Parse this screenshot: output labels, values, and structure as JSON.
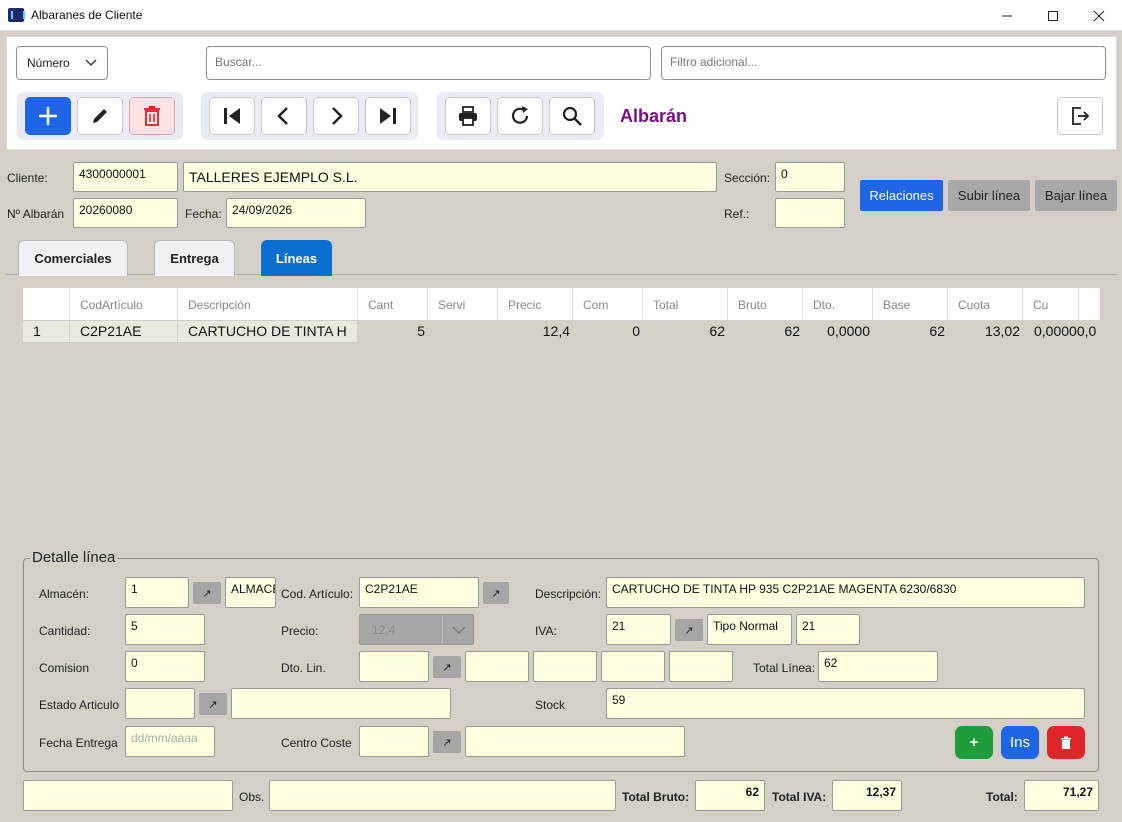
{
  "window": {
    "title": "Albaranes de Cliente"
  },
  "toolbar": {
    "search_mode": "Número",
    "search_placeholder": "Buscar...",
    "filter_placeholder": "Filtro adicional...",
    "doc_title": "Albarán"
  },
  "header": {
    "cliente_label": "Cliente:",
    "cliente_code": "4300000001",
    "cliente_name": "TALLERES EJEMPLO S.L.",
    "seccion_label": "Sección:",
    "seccion_value": "0",
    "albaran_label": "Nº Albarán",
    "albaran_value": "20260080",
    "fecha_label": "Fecha:",
    "fecha_value": "24/09/2026",
    "ref_label": "Ref.:",
    "ref_value": "",
    "relaciones_label": "Relaciones",
    "subir_label": "Subir línea",
    "bajar_label": "Bajar línea"
  },
  "tabs": [
    {
      "label": "Comerciales"
    },
    {
      "label": "Entrega"
    },
    {
      "label": "Líneas"
    }
  ],
  "grid": {
    "columns": [
      "",
      "CodArtículo",
      "Descripción",
      "Cant",
      "Servi",
      "Precic",
      "Com",
      "Total",
      "Bruto",
      "Dto.",
      "Base",
      "Cuota",
      "Cu"
    ],
    "rows": [
      {
        "n": "1",
        "cod": "C2P21AE",
        "desc": "CARTUCHO DE TINTA H",
        "cant": "5",
        "servi": "",
        "precio": "12,4",
        "com": "0",
        "total": "62",
        "bruto": "62",
        "dto": "0,0000",
        "base": "62",
        "cuota": "13,02",
        "cu": "0,00000,0"
      }
    ]
  },
  "detail": {
    "legend": "Detalle línea",
    "almacen_label": "Almacén:",
    "almacen_value": "1",
    "almacen_name": "ALMACE",
    "codart_label": "Cod. Artículo:",
    "codart_value": "C2P21AE",
    "desc_label": "Descripción:",
    "desc_value": "CARTUCHO DE TINTA HP 935 C2P21AE MAGENTA 6230/6830",
    "cantidad_label": "Cantidad:",
    "cantidad_value": "5",
    "precio_label": "Precio:",
    "precio_value": "12,4",
    "iva_label": "IVA:",
    "iva_code": "21",
    "iva_type": "Tipo Normal",
    "iva_pct": "21",
    "comision_label": "Comision",
    "comision_value": "0",
    "dtolin_label": "Dto. Lin.",
    "total_linea_label": "Total Línea:",
    "total_linea_value": "62",
    "estado_label": "Estado Articulo",
    "stock_label": "Stock",
    "stock_value": "59",
    "fecha_entrega_label": "Fecha Entrega",
    "fecha_entrega_placeholder": "dd/mm/aaaa",
    "centro_label": "Centro Coste",
    "add_label": "+",
    "ins_label": "Ins"
  },
  "footer": {
    "obs_label": "Obs.",
    "total_bruto_label": "Total Bruto:",
    "total_bruto_value": "62",
    "total_iva_label": "Total IVA:",
    "total_iva_value": "12,37",
    "total_label": "Total:",
    "total_value": "71,27"
  },
  "colors": {
    "accent": "#1e66e6",
    "title": "#7b0f86",
    "input_bg": "#ffffe1",
    "add": "#1f9d3a",
    "delete": "#e0252b"
  }
}
